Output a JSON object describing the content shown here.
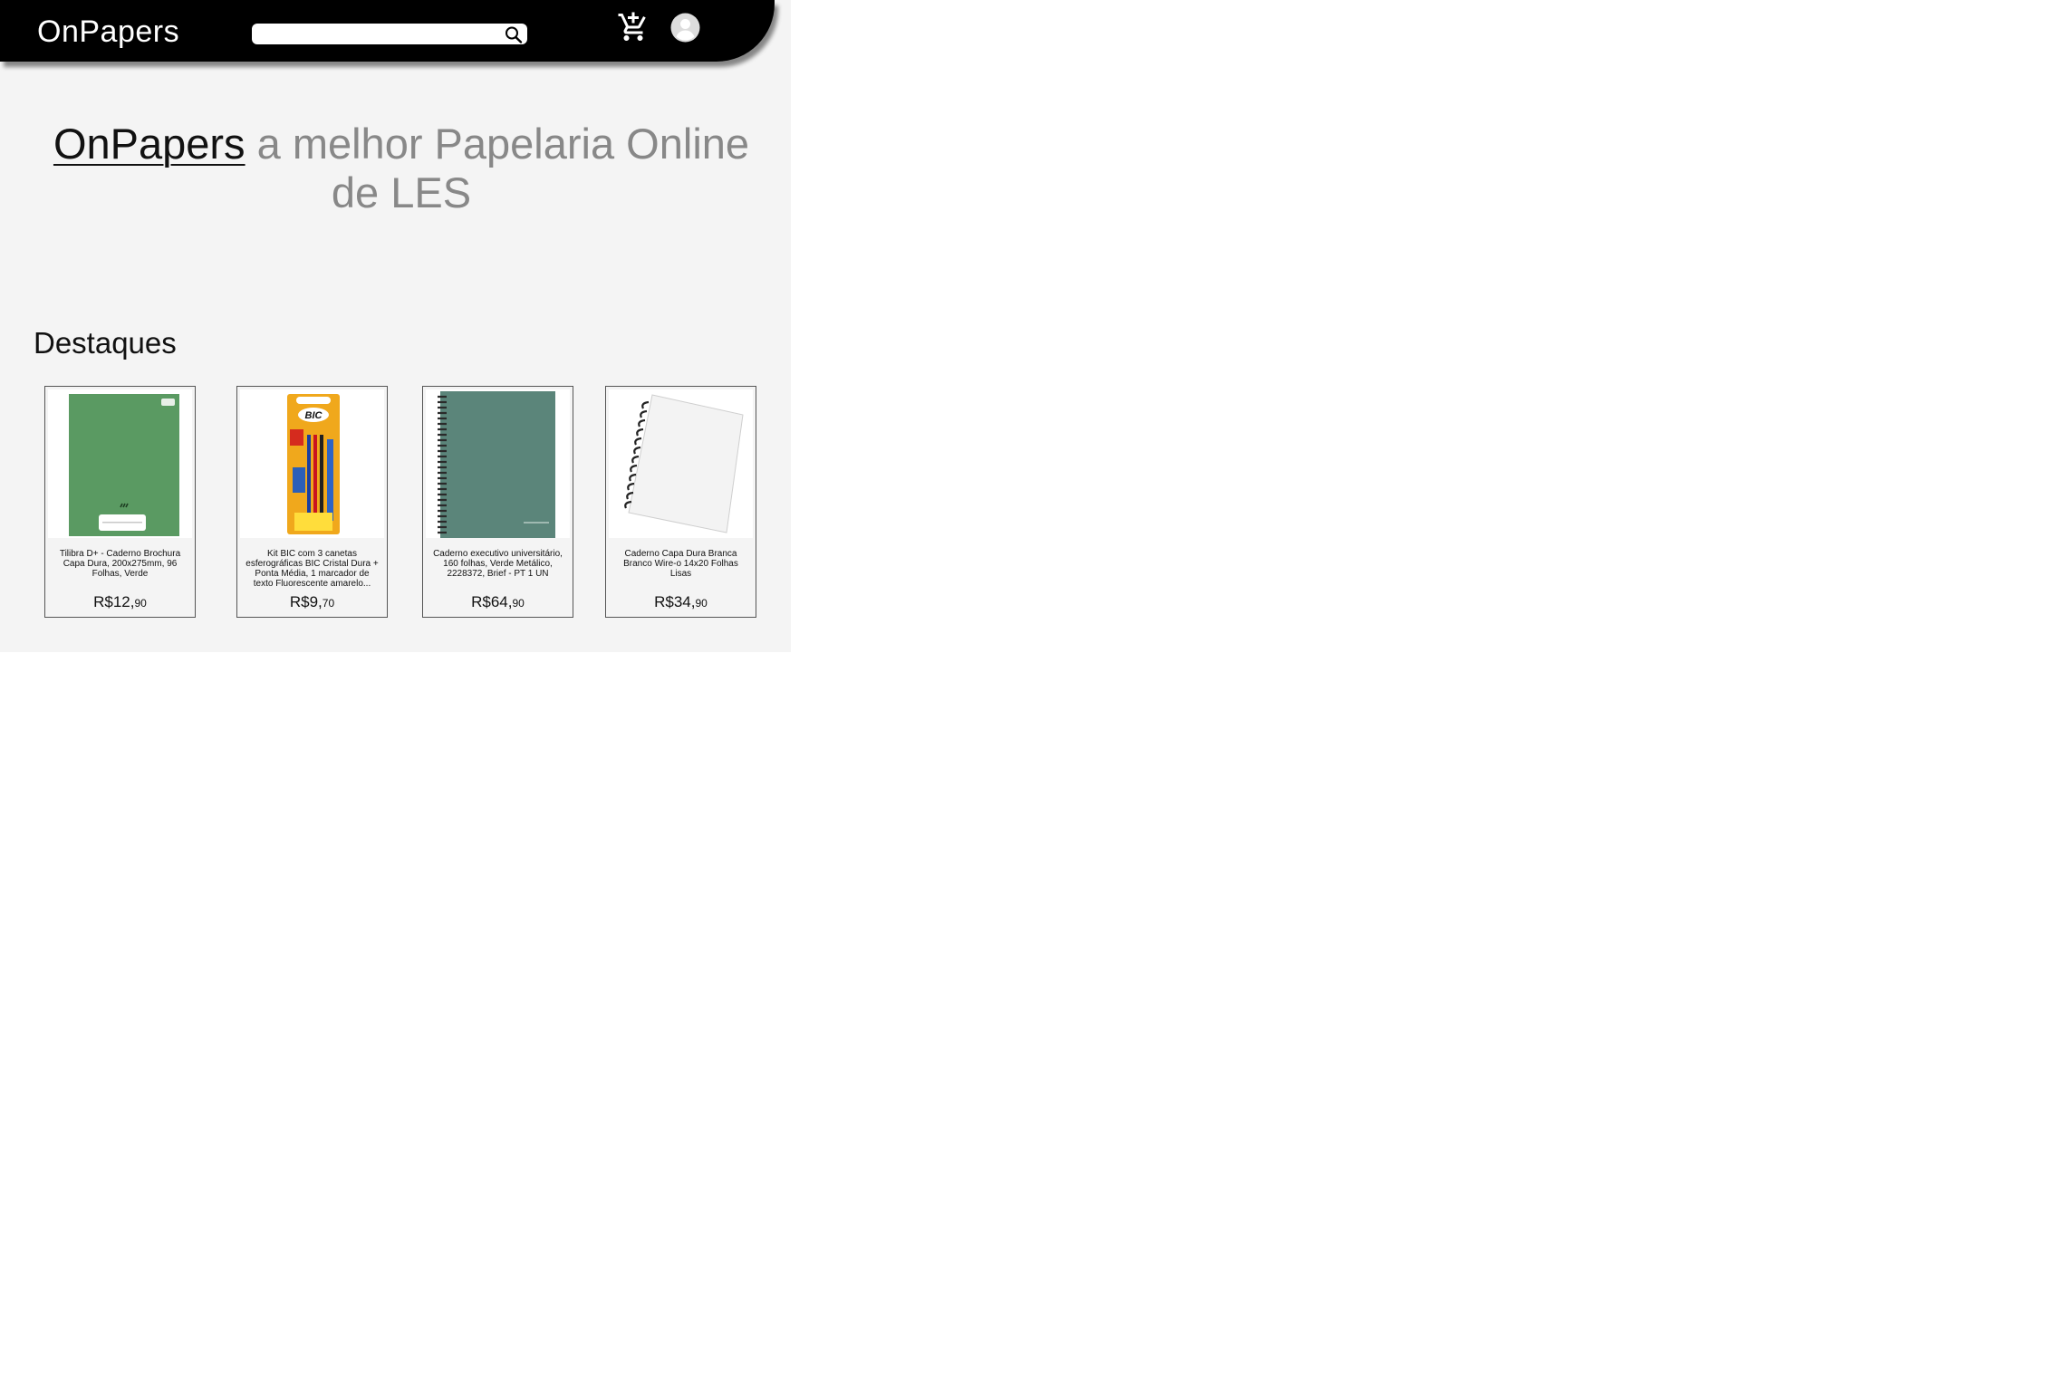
{
  "header": {
    "brand": "OnPapers",
    "search": {
      "value": "",
      "placeholder": ""
    },
    "cart_icon": "add-shopping-cart-icon",
    "user_icon": "account-circle-icon"
  },
  "hero": {
    "brand": "OnPapers",
    "tagline": " a melhor Papelaria Online de LES"
  },
  "featured": {
    "title": "Destaques",
    "products": [
      {
        "title": "Tilibra D+ - Caderno Brochura Capa Dura, 200x275mm, 96 Folhas, Verde",
        "price_main": "R$12,",
        "price_cents": "90",
        "image": "green-notebook-image"
      },
      {
        "title": "Kit BIC com 3 canetas esferográficas BIC Cristal Dura + Ponta Média, 1 marcador de texto Fluorescente amarelo...",
        "price_main": "R$9,",
        "price_cents": "70",
        "image": "bic-pen-kit-image"
      },
      {
        "title": "Caderno executivo universitário, 160 folhas, Verde Metálico, 2228372, Brief - PT 1 UN",
        "price_main": "R$64,",
        "price_cents": "90",
        "image": "spiral-notebook-green-image"
      },
      {
        "title": "Caderno Capa Dura Branca Branco Wire-o 14x20 Folhas Lisas",
        "price_main": "R$34,",
        "price_cents": "90",
        "image": "spiral-notebook-white-image"
      }
    ]
  },
  "colors": {
    "navbar": "#000000",
    "background": "#f4f4f4",
    "hero_muted": "#888888"
  }
}
